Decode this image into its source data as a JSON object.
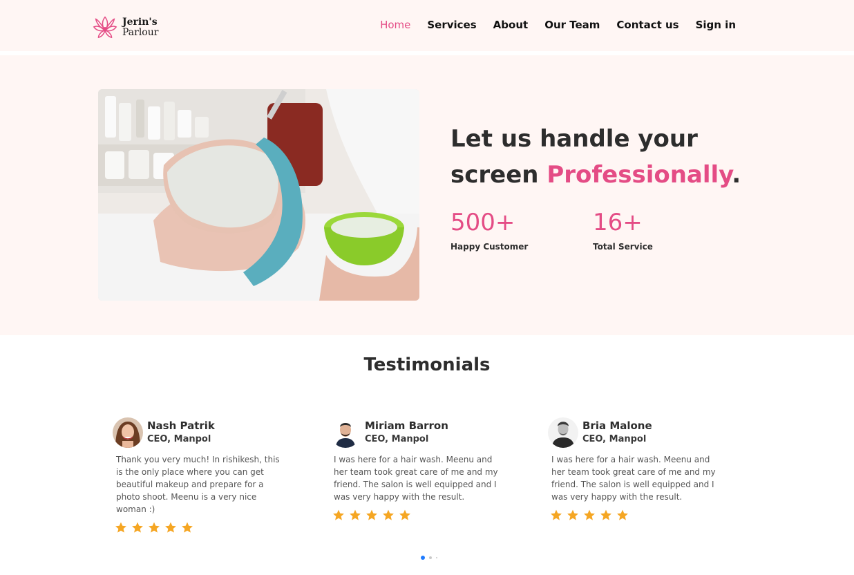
{
  "brand": {
    "line1": "Jerin's",
    "line2": "Parlour",
    "icon": "lotus-icon"
  },
  "nav": {
    "items": [
      {
        "label": "Home",
        "active": true
      },
      {
        "label": "Services"
      },
      {
        "label": "About"
      },
      {
        "label": "Our Team"
      },
      {
        "label": "Contact us"
      },
      {
        "label": "Sign in"
      }
    ]
  },
  "hero": {
    "title_part1": "Let us handle your screen ",
    "title_highlight": "Professionally",
    "title_end": ".",
    "stats": [
      {
        "value": "500+",
        "label": "Happy Customer"
      },
      {
        "value": "16+",
        "label": "Total Service"
      }
    ]
  },
  "testimonials": {
    "heading": "Testimonials",
    "items": [
      {
        "name": "Nash Patrik",
        "role": "CEO, Manpol",
        "quote": "Thank you very much! In rishikesh, this is the only place where you can get beautiful makeup and prepare for a photo shoot. Meenu is a very nice woman :)",
        "rating": 5
      },
      {
        "name": "Miriam Barron",
        "role": "CEO, Manpol",
        "quote": "I was here for a hair wash. Meenu and her team took great care of me and my friend. The salon is well equipped and I was very happy with the result.",
        "rating": 5
      },
      {
        "name": "Bria Malone",
        "role": "CEO, Manpol",
        "quote": "I was here for a hair wash. Meenu and her team took great care of me and my friend. The salon is well equipped and I was very happy with the result.",
        "rating": 5
      }
    ],
    "carousel": {
      "pages": 3,
      "active_page": 1
    }
  },
  "colors": {
    "accent": "#e44c85",
    "hero_bg": "#fff6f4",
    "star": "#f5a623",
    "dot_active": "#1e7bff"
  }
}
